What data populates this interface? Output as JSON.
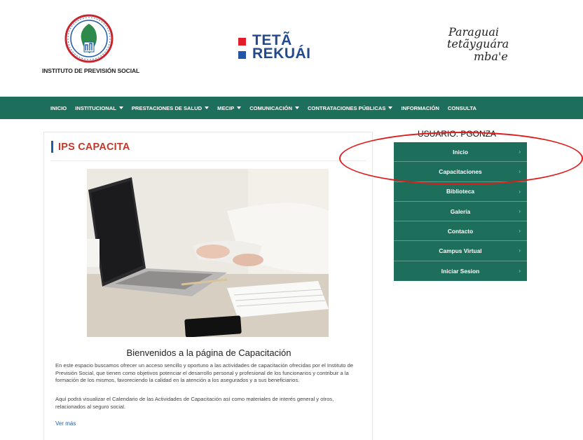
{
  "header": {
    "ips_name": "INSTITUTO DE PREVISIÓN SOCIAL",
    "teta_line1": "TETÃ",
    "teta_line2": "REKUÁI",
    "slogan_line1": "Paraguai",
    "slogan_line2": "tetãyguára",
    "slogan_line3": "mba'e"
  },
  "nav": {
    "items": [
      {
        "label": "INICIO",
        "dropdown": false
      },
      {
        "label": "INSTITUCIONAL",
        "dropdown": true
      },
      {
        "label": "PRESTACIONES DE SALUD",
        "dropdown": true
      },
      {
        "label": "MECIP",
        "dropdown": true
      },
      {
        "label": "COMUNICACIÓN",
        "dropdown": true
      },
      {
        "label": "CONTRATACIONES PÚBLICAS",
        "dropdown": true
      },
      {
        "label": "INFORMACIÓN",
        "dropdown": false
      },
      {
        "label": "CONSULTA",
        "dropdown": false
      }
    ]
  },
  "main": {
    "title": "IPS CAPACITA",
    "welcome": "Bienvenidos a la página de Capacitación",
    "para1": "En este espacio buscamos ofrecer un acceso sencillo y oportuno a las actividades de capacitación ofrecidas por el Instituto de Previsión Social, que tienen como objetivos potenciar el desarrollo personal y profesional de los funcionarios y contribuir a la formación de los mismos, favoreciendo la calidad en la atención a los asegurados y a sus beneficiarios.",
    "para2": "Aquí podrá visualizar el Calendario de las Actividades de Capacitación así como materiales de interés general y otros, relacionados al seguro social.",
    "more_link": "Ver más"
  },
  "sidebar": {
    "user_label": "USUARIO: PGONZA",
    "items": [
      {
        "label": "Inicio"
      },
      {
        "label": "Capacitaciones"
      },
      {
        "label": "Biblioteca"
      },
      {
        "label": "Galería"
      },
      {
        "label": "Contacto"
      },
      {
        "label": "Campus Virtual"
      },
      {
        "label": "Iniciar Sesion"
      }
    ],
    "chevron": "›"
  },
  "colors": {
    "nav_green": "#1d6e5a",
    "title_red": "#c0392b",
    "link_blue": "#1f5fa8",
    "annotation_red": "#e01b1b"
  }
}
